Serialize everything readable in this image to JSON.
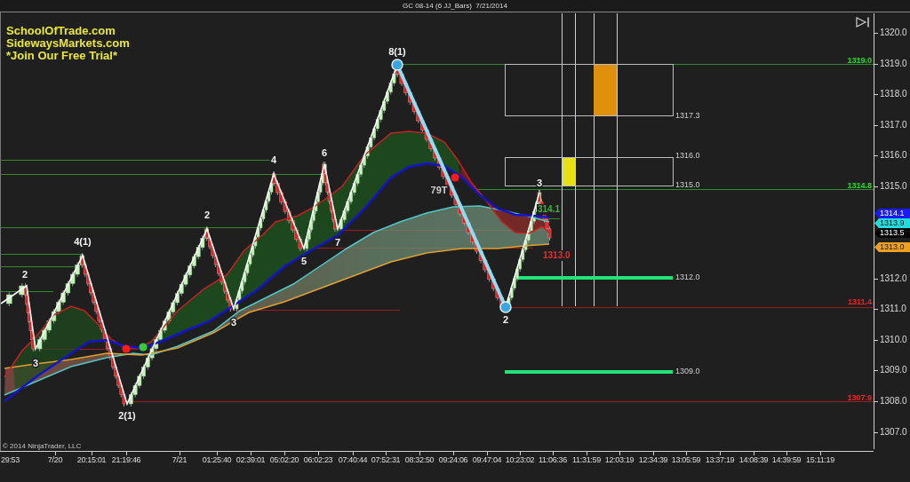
{
  "window": {
    "title": "GC 08-14 (6 JJ_Bars)  7/21/2014"
  },
  "promo_text": [
    "SchoolOfTrade.com",
    "SidewaysMarkets.com",
    "*Join Our Free Trial*"
  ],
  "chart": {
    "wave_labels": [
      "2",
      "4(1)",
      "3",
      "2(1)",
      "2",
      "3",
      "4",
      "5",
      "6",
      "7",
      "8(1)",
      "79T",
      "3",
      "2"
    ],
    "zone_labels": [
      "1317.3",
      "1316.0",
      "1315.0",
      "1312.0",
      "1309.0"
    ],
    "level_labels": [
      {
        "text": "1319.0",
        "color": "#22dd22"
      },
      {
        "text": "1314.8",
        "color": "#22dd22"
      },
      {
        "text": "1311.4",
        "color": "#ee2222"
      },
      {
        "text": "1307.9",
        "color": "#ee2222"
      }
    ],
    "bar_labels": [
      {
        "text": "314.1",
        "color": "#33bb33"
      },
      {
        "text": "1313.0",
        "color": "#dd3333"
      }
    ],
    "copyright": "© 2014 NinjaTrader, LLC"
  },
  "price_axis": {
    "ticks": [
      "1320.0",
      "1319.0",
      "1318.0",
      "1317.0",
      "1316.0",
      "1315.0",
      "1312.0",
      "1311.0",
      "1310.0",
      "1309.0",
      "1308.0",
      "1307.0"
    ],
    "markers": [
      {
        "text": "1314.1",
        "color": "#1a1aff"
      },
      {
        "text": "1313.9",
        "color": "#22dddd"
      },
      {
        "text": "1313.5",
        "color": "#000000"
      },
      {
        "text": "1313.0",
        "color": "#f0a020"
      }
    ]
  },
  "time_axis": {
    "ticks": [
      "29:53",
      "7/20",
      "20:15:01",
      "21:19:46",
      "7/21",
      "01:25:40",
      "02:39:01",
      "05:02:20",
      "06:02:23",
      "07:40:44",
      "07:52:31",
      "08:32:50",
      "09:24:06",
      "09:47:04",
      "10:23:02",
      "11:06:36",
      "11:31:59",
      "12:03:19",
      "12:34:39",
      "13:05:59",
      "13:37:19",
      "14:08:39",
      "14:39:59",
      "15:11:19"
    ]
  }
}
